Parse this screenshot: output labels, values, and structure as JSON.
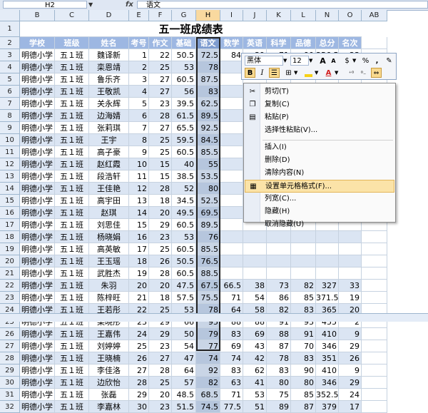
{
  "formula_bar": {
    "name_box": "H2",
    "fx_label": "fx",
    "value": "语文"
  },
  "columns": [
    "B",
    "C",
    "D",
    "E",
    "F",
    "G",
    "H",
    "I",
    "J",
    "K",
    "L",
    "N",
    "O",
    "AB"
  ],
  "selected_column": "H",
  "title": "五一班成绩表",
  "headers": [
    "学校",
    "班级",
    "姓名",
    "考号",
    "作文",
    "基础",
    "语文",
    "数学",
    "英语",
    "科学",
    "品德",
    "总分",
    "名次"
  ],
  "rows": [
    {
      "n": "3",
      "c": [
        "明德小学",
        "五１班",
        "魏译新",
        "1",
        "22",
        "50.5",
        "72.5",
        "84",
        "39",
        "71",
        "90",
        "356.5",
        "23"
      ]
    },
    {
      "n": "4",
      "c": [
        "明德小学",
        "五１班",
        "栾恩靖",
        "2",
        "25",
        "53",
        "78",
        "",
        "",
        "",
        "",
        "",
        ""
      ]
    },
    {
      "n": "5",
      "c": [
        "明德小学",
        "五１班",
        "鲁乐齐",
        "3",
        "27",
        "60.5",
        "87.5",
        "",
        "",
        "",
        "",
        "",
        ""
      ]
    },
    {
      "n": "6",
      "c": [
        "明德小学",
        "五１班",
        "王敬凯",
        "4",
        "27",
        "56",
        "83",
        "",
        "",
        "",
        "",
        "",
        ""
      ]
    },
    {
      "n": "7",
      "c": [
        "明德小学",
        "五１班",
        "关永辉",
        "5",
        "23",
        "39.5",
        "62.5",
        "",
        "",
        "",
        "",
        "",
        ""
      ]
    },
    {
      "n": "8",
      "c": [
        "明德小学",
        "五１班",
        "边海婧",
        "6",
        "28",
        "61.5",
        "89.5",
        "",
        "",
        "",
        "",
        "",
        ""
      ]
    },
    {
      "n": "9",
      "c": [
        "明德小学",
        "五１班",
        "张莉琪",
        "7",
        "27",
        "65.5",
        "92.5",
        "",
        "",
        "",
        "",
        "",
        ""
      ]
    },
    {
      "n": "10",
      "c": [
        "明德小学",
        "五１班",
        "王宇",
        "8",
        "25",
        "59.5",
        "84.5",
        "",
        "",
        "",
        "",
        "",
        ""
      ]
    },
    {
      "n": "11",
      "c": [
        "明德小学",
        "五１班",
        "高子豪",
        "9",
        "25",
        "60.5",
        "85.5",
        "",
        "",
        "",
        "",
        "",
        ""
      ]
    },
    {
      "n": "12",
      "c": [
        "明德小学",
        "五１班",
        "赵红霞",
        "10",
        "15",
        "40",
        "55",
        "",
        "",
        "",
        "",
        "",
        ""
      ]
    },
    {
      "n": "13",
      "c": [
        "明德小学",
        "五１班",
        "段浩轩",
        "11",
        "15",
        "38.5",
        "53.5",
        "",
        "",
        "",
        "",
        "",
        ""
      ]
    },
    {
      "n": "14",
      "c": [
        "明德小学",
        "五１班",
        "王佳艳",
        "12",
        "28",
        "52",
        "80",
        "",
        "",
        "",
        "",
        "",
        ""
      ]
    },
    {
      "n": "15",
      "c": [
        "明德小学",
        "五１班",
        "高宇田",
        "13",
        "18",
        "34.5",
        "52.5",
        "",
        "",
        "",
        "",
        "",
        ""
      ]
    },
    {
      "n": "16",
      "c": [
        "明德小学",
        "五１班",
        "赵琪",
        "14",
        "20",
        "49.5",
        "69.5",
        "",
        "",
        "",
        "",
        "",
        ""
      ]
    },
    {
      "n": "17",
      "c": [
        "明德小学",
        "五１班",
        "刘思佳",
        "15",
        "29",
        "60.5",
        "89.5",
        "",
        "",
        "",
        "",
        "",
        ""
      ]
    },
    {
      "n": "18",
      "c": [
        "明德小学",
        "五１班",
        "杨晓娟",
        "16",
        "23",
        "53",
        "76",
        "",
        "",
        "",
        "",
        "",
        ""
      ]
    },
    {
      "n": "19",
      "c": [
        "明德小学",
        "五１班",
        "高英敏",
        "17",
        "25",
        "60.5",
        "85.5",
        "",
        "",
        "",
        "",
        "",
        ""
      ]
    },
    {
      "n": "20",
      "c": [
        "明德小学",
        "五１班",
        "王玉瑶",
        "18",
        "26",
        "50.5",
        "76.5",
        "",
        "",
        "",
        "",
        "",
        ""
      ]
    },
    {
      "n": "21",
      "c": [
        "明德小学",
        "五１班",
        "武胜杰",
        "19",
        "28",
        "60.5",
        "88.5",
        "",
        "",
        "",
        "",
        "",
        ""
      ]
    },
    {
      "n": "22",
      "c": [
        "明德小学",
        "五１班",
        "朱羽",
        "20",
        "20",
        "47.5",
        "67.5",
        "66.5",
        "38",
        "73",
        "82",
        "327",
        "33"
      ]
    },
    {
      "n": "23",
      "c": [
        "明德小学",
        "五１班",
        "陈梓旺",
        "21",
        "18",
        "57.5",
        "75.5",
        "71",
        "54",
        "86",
        "85",
        "371.5",
        "19"
      ]
    },
    {
      "n": "24",
      "c": [
        "明德小学",
        "五１班",
        "王若彤",
        "22",
        "25",
        "53",
        "78",
        "64",
        "58",
        "82",
        "83",
        "365",
        "20"
      ]
    },
    {
      "n": "25",
      "c": [
        "明德小学",
        "五１班",
        "栾晓彤",
        "23",
        "29",
        "66",
        "95",
        "88",
        "88",
        "91",
        "93",
        "455",
        "2"
      ]
    },
    {
      "n": "26",
      "c": [
        "明德小学",
        "五１班",
        "王嘉伟",
        "24",
        "29",
        "50",
        "79",
        "83",
        "69",
        "88",
        "91",
        "410",
        "9"
      ]
    },
    {
      "n": "27",
      "c": [
        "明德小学",
        "五１班",
        "刘婷婷",
        "25",
        "23",
        "54",
        "77",
        "69",
        "43",
        "87",
        "70",
        "346",
        "29"
      ]
    },
    {
      "n": "28",
      "c": [
        "明德小学",
        "五１班",
        "王晓楠",
        "26",
        "27",
        "47",
        "74",
        "74",
        "42",
        "78",
        "83",
        "351",
        "26"
      ]
    },
    {
      "n": "29",
      "c": [
        "明德小学",
        "五１班",
        "李佳洛",
        "27",
        "28",
        "64",
        "92",
        "83",
        "62",
        "83",
        "90",
        "410",
        "9"
      ]
    },
    {
      "n": "30",
      "c": [
        "明德小学",
        "五１班",
        "边欣怡",
        "28",
        "25",
        "57",
        "82",
        "63",
        "41",
        "80",
        "80",
        "346",
        "29"
      ]
    },
    {
      "n": "31",
      "c": [
        "明德小学",
        "五１班",
        "张磊",
        "29",
        "20",
        "48.5",
        "68.5",
        "71",
        "53",
        "75",
        "85",
        "352.5",
        "24"
      ]
    },
    {
      "n": "32",
      "c": [
        "明德小学",
        "五１班",
        "李嘉林",
        "30",
        "23",
        "51.5",
        "74.5",
        "77.5",
        "51",
        "89",
        "87",
        "379",
        "17"
      ]
    }
  ],
  "mini_toolbar": {
    "font": "黑体",
    "size": "12",
    "grow_font": "A",
    "shrink_font": "A",
    "currency": "$",
    "percent": "%",
    "comma": ",",
    "bold": "B",
    "italic": "I",
    "fill_color": "#f7d117",
    "font_color": "#d21f1f"
  },
  "context_menu": {
    "items": [
      {
        "label": "剪切(T)",
        "icon": "scissors-icon",
        "glyph": "✂"
      },
      {
        "label": "复制(C)",
        "icon": "copy-icon",
        "glyph": "❐"
      },
      {
        "label": "粘贴(P)",
        "icon": "paste-icon",
        "glyph": "▤"
      },
      {
        "label": "选择性粘贴(V)...",
        "icon": "",
        "glyph": ""
      },
      {
        "label": "插入(I)",
        "icon": "",
        "glyph": ""
      },
      {
        "label": "删除(D)",
        "icon": "",
        "glyph": ""
      },
      {
        "label": "清除内容(N)",
        "icon": "",
        "glyph": ""
      },
      {
        "label": "设置单元格格式(F)...",
        "icon": "format-cells-icon",
        "glyph": "▦"
      },
      {
        "label": "列宽(C)...",
        "icon": "",
        "glyph": ""
      },
      {
        "label": "隐藏(H)",
        "icon": "",
        "glyph": ""
      },
      {
        "label": "取消隐藏(U)",
        "icon": "",
        "glyph": ""
      }
    ],
    "highlighted_index": 7
  },
  "colors": {
    "header_fill": "#9db7e2",
    "band_fill": "#dbe5f3",
    "menu_highlight": "#fbe3a8",
    "selection_header": "#f9d99f"
  }
}
